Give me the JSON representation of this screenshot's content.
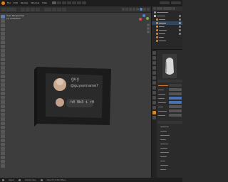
{
  "window": {
    "app": "Blender"
  },
  "menubar": {
    "items": [
      "File",
      "Edit",
      "Render",
      "Window",
      "Help"
    ]
  },
  "viewport": {
    "mode": "Object Mode",
    "view_label": "User Perspective",
    "collection_label": "(1) Collection"
  },
  "card": {
    "name": "guy",
    "handle": "@guysername?",
    "button_label": "h0 0b3 i r0",
    "colors": {
      "frame": "#1b1b1b",
      "panel": "#2a2a2a",
      "avatar": "#c9a98f",
      "button": "#3a3a3a"
    }
  },
  "outliner": {
    "rows": 9
  },
  "properties": {
    "sections": 14
  },
  "statusbar": {
    "items": [
      "Select",
      "Rotate View",
      "Object Context Menu"
    ]
  },
  "colors": {
    "accent": "#4772b3",
    "active_tab": "#d58a2a",
    "background": "#3d3d3d"
  }
}
